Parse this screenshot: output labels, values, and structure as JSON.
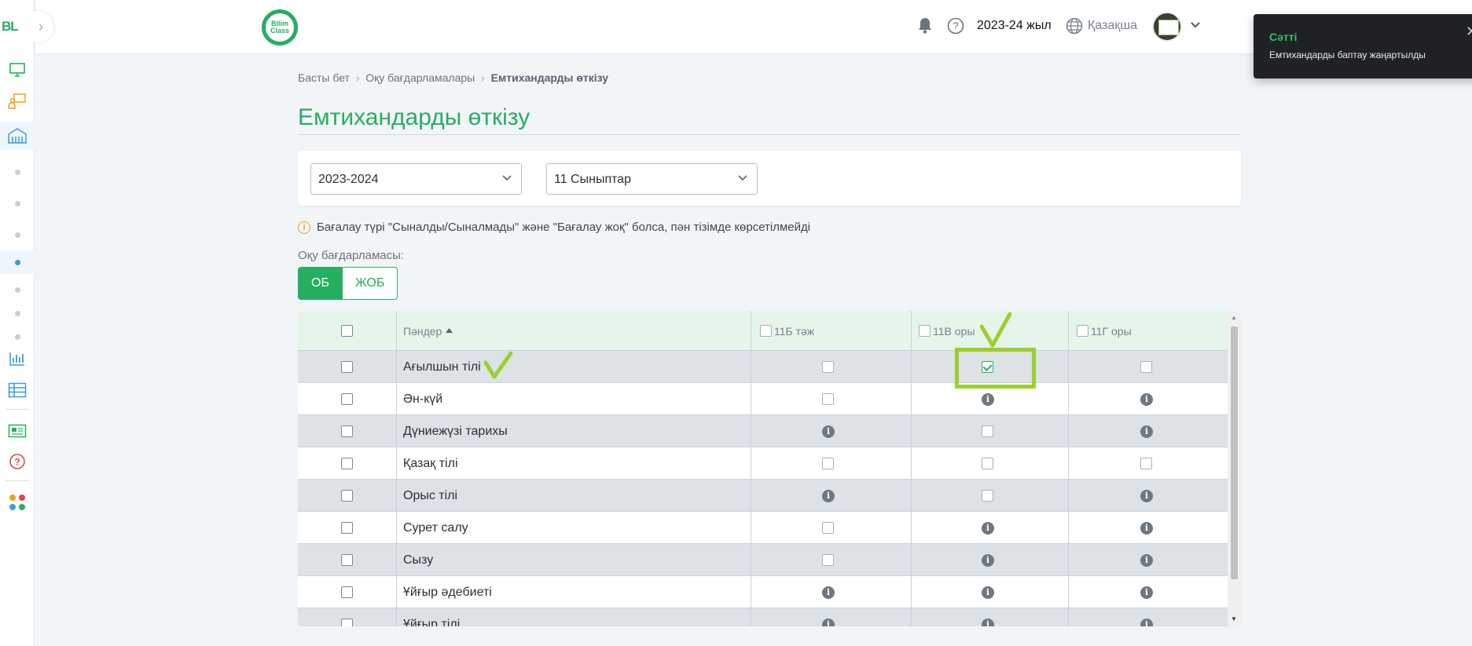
{
  "sidebar": {
    "logo": "BL",
    "items": [
      {
        "icon": "monitor-icon",
        "color": "#27ae60"
      },
      {
        "icon": "teacher-board-icon",
        "color": "#f0a020"
      },
      {
        "icon": "school-building-icon",
        "color": "#3a9bdc"
      },
      {
        "icon": "chart-bars-icon",
        "color": "#3a9bdc"
      },
      {
        "icon": "table-grid-icon",
        "color": "#3a9bdc"
      },
      {
        "icon": "news-icon",
        "color": "#27ae60"
      },
      {
        "icon": "help-circle-icon",
        "color": "#e04848"
      },
      {
        "icon": "apps-icon",
        "color": "#f0a020"
      }
    ]
  },
  "header": {
    "brand_line1": "Bilim",
    "brand_line2": "Class",
    "year": "2023-24 жыл",
    "language": "Қазақша"
  },
  "toast": {
    "title": "Сәтті",
    "message": "Емтихандарды баптау жаңартылды",
    "title_color": "#27c46b"
  },
  "breadcrumb": {
    "home": "Басты бет",
    "programs": "Оқу бағдарламалары",
    "current": "Емтихандарды өткізу"
  },
  "page": {
    "title": "Емтихандарды өткізу"
  },
  "filters": {
    "year_value": "2023-2024",
    "class_value": "11 Сыныптар"
  },
  "notice": "Бағалау түрі \"Сыналды/Сыналмады\" және \"Бағалау жоқ\" болса, пән тізімде көрсетілмейді",
  "program": {
    "label": "Оқу бағдарламасы:",
    "options": [
      "ОБ",
      "ЖОБ"
    ],
    "selected": "ОБ"
  },
  "table": {
    "subject_header": "Пәндер",
    "class_headers": [
      "11Б тәж",
      "11В оры",
      "11Г оры"
    ],
    "rows": [
      {
        "subject": "Ағылшын тілі",
        "cells": [
          "checkbox",
          "checked",
          "checkbox"
        ]
      },
      {
        "subject": "Ән-күй",
        "cells": [
          "checkbox",
          "info",
          "info"
        ]
      },
      {
        "subject": "Дүниежүзі тарихы",
        "cells": [
          "info",
          "checkbox",
          "info"
        ]
      },
      {
        "subject": "Қазақ тілі",
        "cells": [
          "checkbox",
          "checkbox",
          "checkbox"
        ]
      },
      {
        "subject": "Орыс тілі",
        "cells": [
          "info",
          "checkbox",
          "info"
        ]
      },
      {
        "subject": "Сурет салу",
        "cells": [
          "checkbox",
          "info",
          "info"
        ]
      },
      {
        "subject": "Сызу",
        "cells": [
          "checkbox",
          "info",
          "info"
        ]
      },
      {
        "subject": "Ұйғыр әдебиеті",
        "cells": [
          "info",
          "info",
          "info"
        ]
      },
      {
        "subject": "Ұйғыр тілі",
        "cells": [
          "info",
          "info",
          "info"
        ]
      }
    ]
  },
  "colors": {
    "accent": "#27ae60",
    "annotation": "#9ccf2d",
    "row_stripe": "#dde2e7"
  }
}
